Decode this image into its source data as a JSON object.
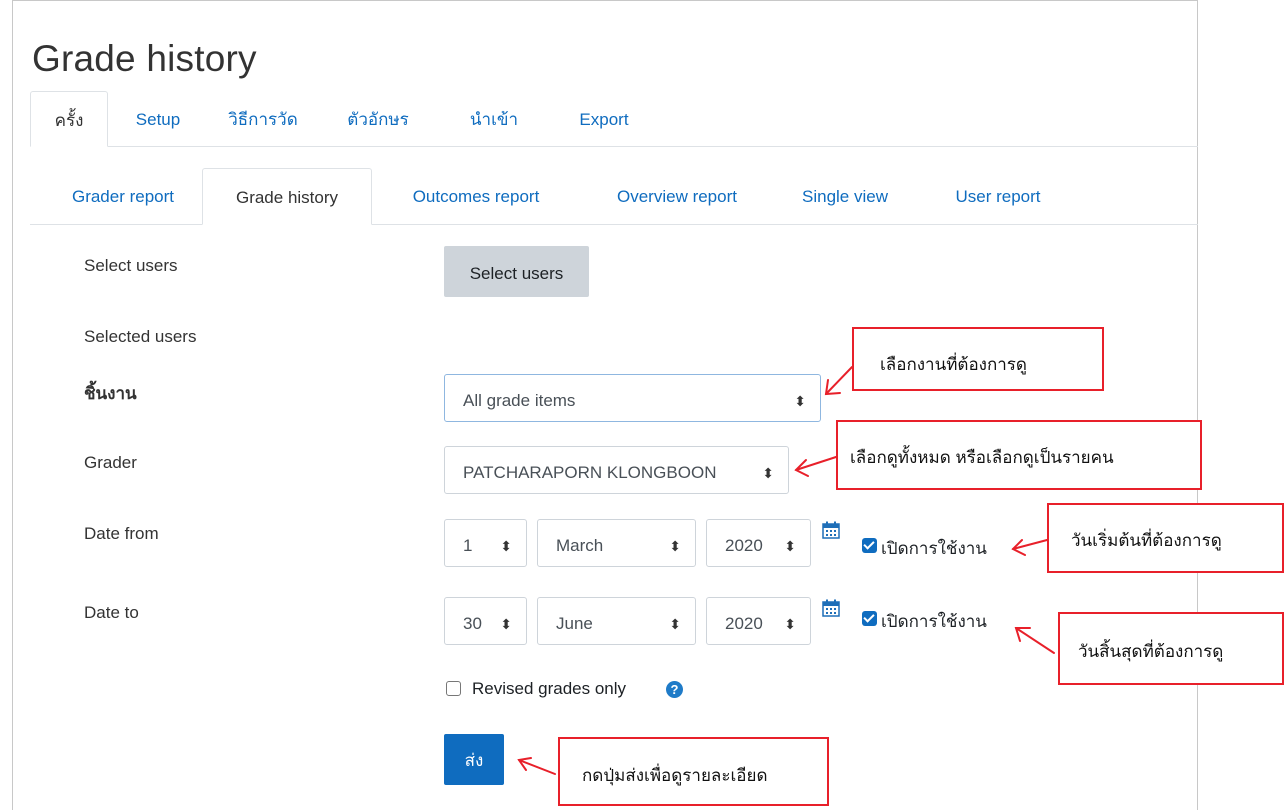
{
  "page": {
    "title": "Grade history"
  },
  "tabs_primary": [
    "ครั้ง",
    "Setup",
    "วิธีการวัด",
    "ตัวอักษร",
    "นำเข้า",
    "Export"
  ],
  "tabs_secondary": [
    "Grader report",
    "Grade history",
    "Outcomes report",
    "Overview report",
    "Single view",
    "User report"
  ],
  "form": {
    "select_users_label": "Select users",
    "select_users_button": "Select users",
    "selected_users_label": "Selected users",
    "grade_item_label": "ชิ้นงาน",
    "grade_item_value": "All grade items",
    "grader_label": "Grader",
    "grader_value": "PATCHARAPORN KLONGBOON",
    "date_from_label": "Date from",
    "date_from": {
      "day": "1",
      "month": "March",
      "year": "2020",
      "enable_label": "เปิดการใช้งาน"
    },
    "date_to_label": "Date to",
    "date_to": {
      "day": "30",
      "month": "June",
      "year": "2020",
      "enable_label": "เปิดการใช้งาน"
    },
    "revised_label": "Revised grades only",
    "submit_label": "ส่ง"
  },
  "callouts": {
    "grade_item": "เลือกงานที่ต้องการดู",
    "grader": "เลือกดูทั้งหมด หรือเลือกดูเป็นรายคน",
    "date_from": "วันเริ่มต้นที่ต้องการดู",
    "date_to": "วันสิ้นสุดที่ต้องการดู",
    "submit": "กดปุ่มส่งเพื่อดูรายละเอียด"
  },
  "icons": {
    "select_arrow": "up-down-arrow-icon",
    "calendar": "calendar-icon",
    "help": "question-circle-icon"
  },
  "colors": {
    "link": "#0f6cbf",
    "primary_button": "#0f6cbf",
    "callout_border": "#e8202a"
  }
}
